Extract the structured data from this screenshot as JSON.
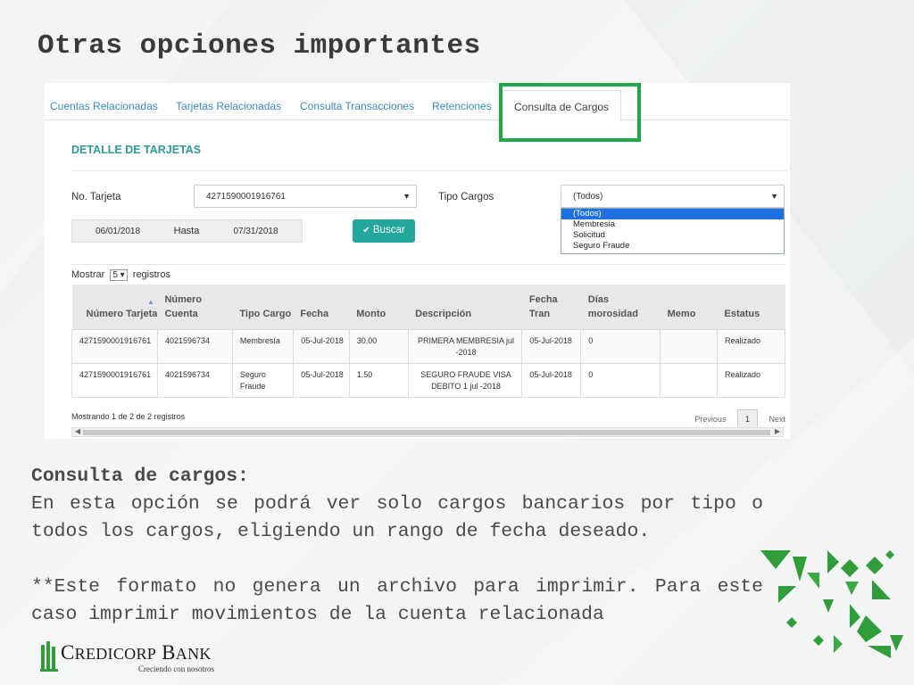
{
  "slide": {
    "title": "Otras opciones importantes"
  },
  "tabs": [
    {
      "label": "Cuentas Relacionadas"
    },
    {
      "label": "Tarjetas Relacionadas"
    },
    {
      "label": "Consulta Transacciones"
    },
    {
      "label": "Retenciones"
    },
    {
      "label": "Consulta de Cargos",
      "active": true
    }
  ],
  "form": {
    "section_title": "DETALLE DE TARJETAS",
    "card_label": "No. Tarjeta",
    "card_value": "4271590001916761",
    "type_label": "Tipo Cargos",
    "type_value": "(Todos)",
    "type_options": [
      "(Todos)",
      "Membresia",
      "Solicitud",
      "Seguro Fraude"
    ],
    "date_from": "06/01/2018",
    "date_sep": "Hasta",
    "date_to": "07/31/2018",
    "search_label": "Buscar"
  },
  "table": {
    "show_prefix": "Mostrar",
    "page_length": "5",
    "show_suffix": "registros",
    "headers": [
      "Número Tarjeta",
      "Número Cuenta",
      "Tipo Cargo",
      "Fecha",
      "Monto",
      "Descripción",
      "Fecha Tran",
      "Días morosidad",
      "Memo",
      "Estatus"
    ],
    "rows": [
      [
        "4271590001916761",
        "4021596734",
        "Membresía",
        "05-Jul-2018",
        "30.00",
        "PRIMERA MEMBRESIA jul -2018",
        "05-Jul-2018",
        "0",
        "",
        "Realizado"
      ],
      [
        "4271590001916761",
        "4021596734",
        "Seguro Fraude",
        "05-Jul-2018",
        "1.50",
        "SEGURO FRAUDE VISA DEBITO 1 jul -2018",
        "05-Jul-2018",
        "0",
        "",
        "Realizado"
      ]
    ],
    "info": "Mostrando 1 de 2 de 2 registros",
    "prev": "Previous",
    "page": "1",
    "next": "Next"
  },
  "body": {
    "heading": "Consulta de cargos:",
    "paragraph": "En esta opción se podrá ver solo cargos bancarios por tipo o todos los cargos, eligiendo un rango de fecha deseado.",
    "note": "**Este formato no genera un archivo para imprimir. Para este caso imprimir movimientos de la cuenta relacionada"
  },
  "logo": {
    "name": "CREDICORP BANK",
    "tagline": "Creciendo con nosotros"
  },
  "colors": {
    "highlight": "#1fa84a",
    "teal": "#21a79d",
    "tab_link": "#3b8bc1",
    "selected_option": "#1e6fe0"
  }
}
